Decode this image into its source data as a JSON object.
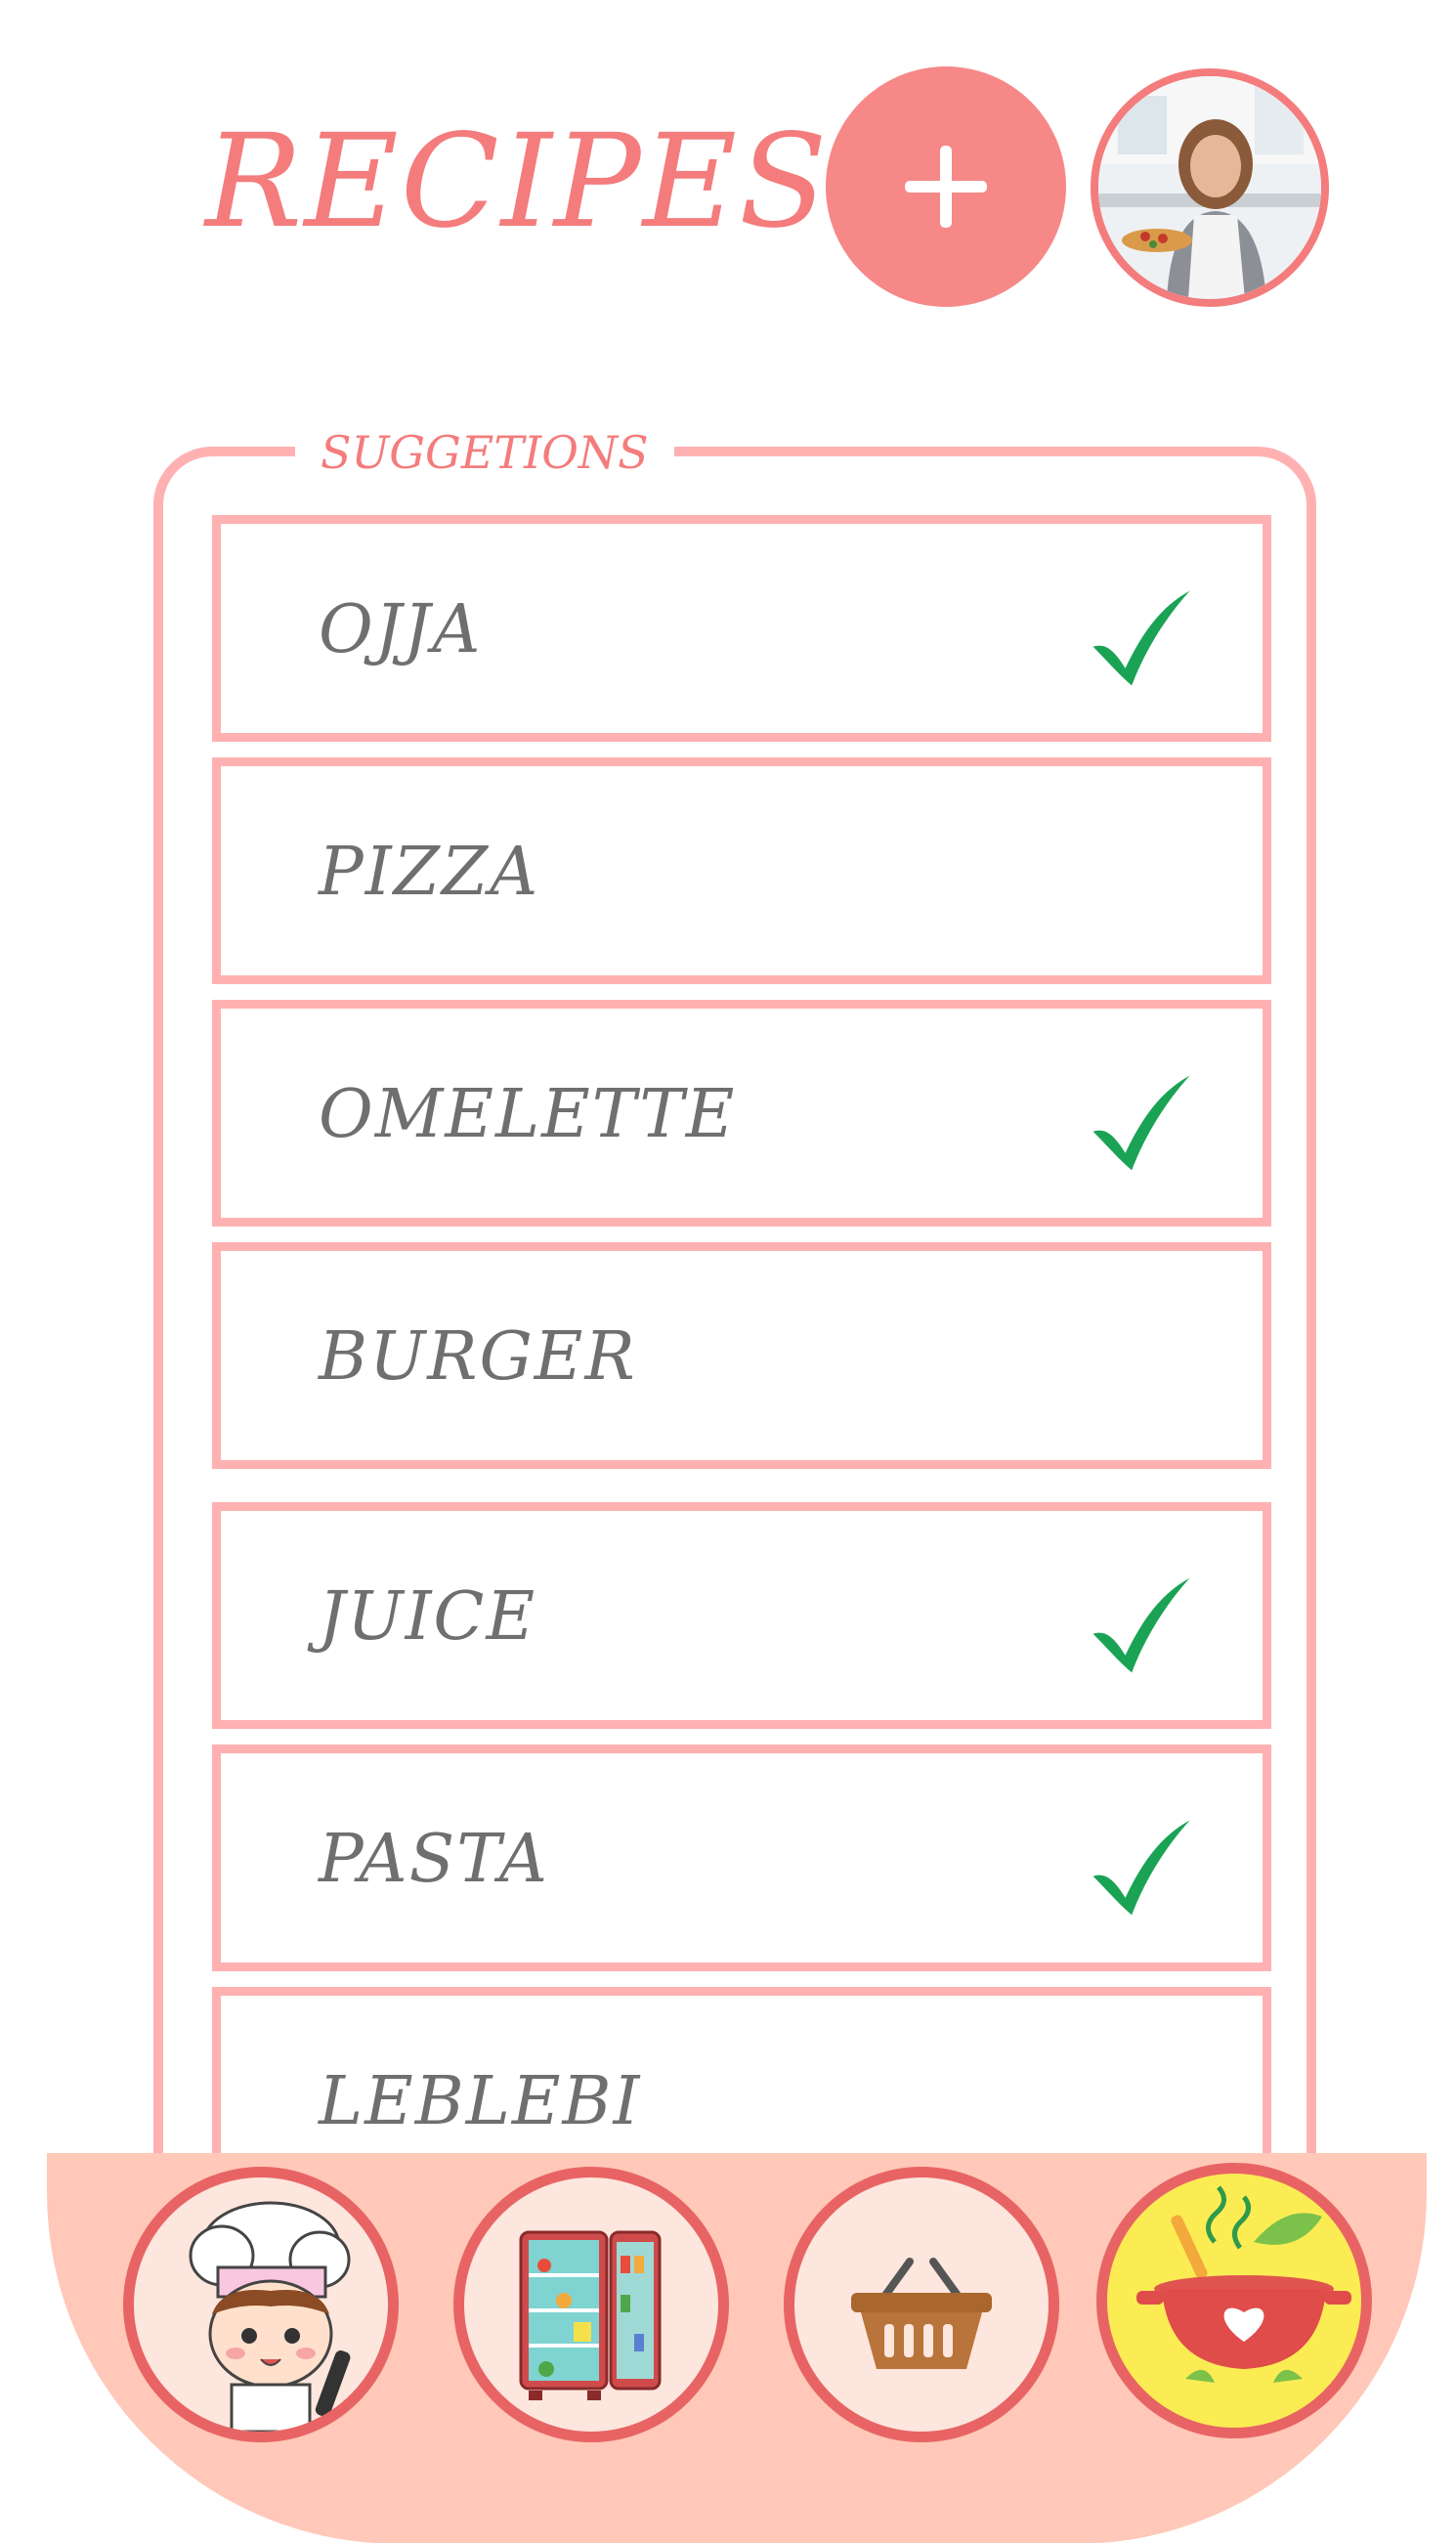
{
  "header": {
    "title": "RECIPES",
    "add_label": "+"
  },
  "suggestions": {
    "legend": "SUGGETIONS",
    "items": [
      {
        "label": "OJJA",
        "checked": true
      },
      {
        "label": "PIZZA",
        "checked": false
      },
      {
        "label": "OMELETTE",
        "checked": true
      },
      {
        "label": "BURGER",
        "checked": false
      },
      {
        "label": "JUICE",
        "checked": true
      },
      {
        "label": "PASTA",
        "checked": true
      },
      {
        "label": "LEBLEBI",
        "checked": false
      }
    ]
  },
  "nav": {
    "items": [
      {
        "name": "chef-icon"
      },
      {
        "name": "fridge-icon"
      },
      {
        "name": "basket-icon"
      },
      {
        "name": "cooking-pot-icon",
        "active": true
      }
    ]
  },
  "colors": {
    "accent": "#f47c7c",
    "panel_border": "#ffb1b1",
    "check": "#1aa354",
    "bottom_bar": "#ffc8b8",
    "active_nav": "#fcec54"
  }
}
